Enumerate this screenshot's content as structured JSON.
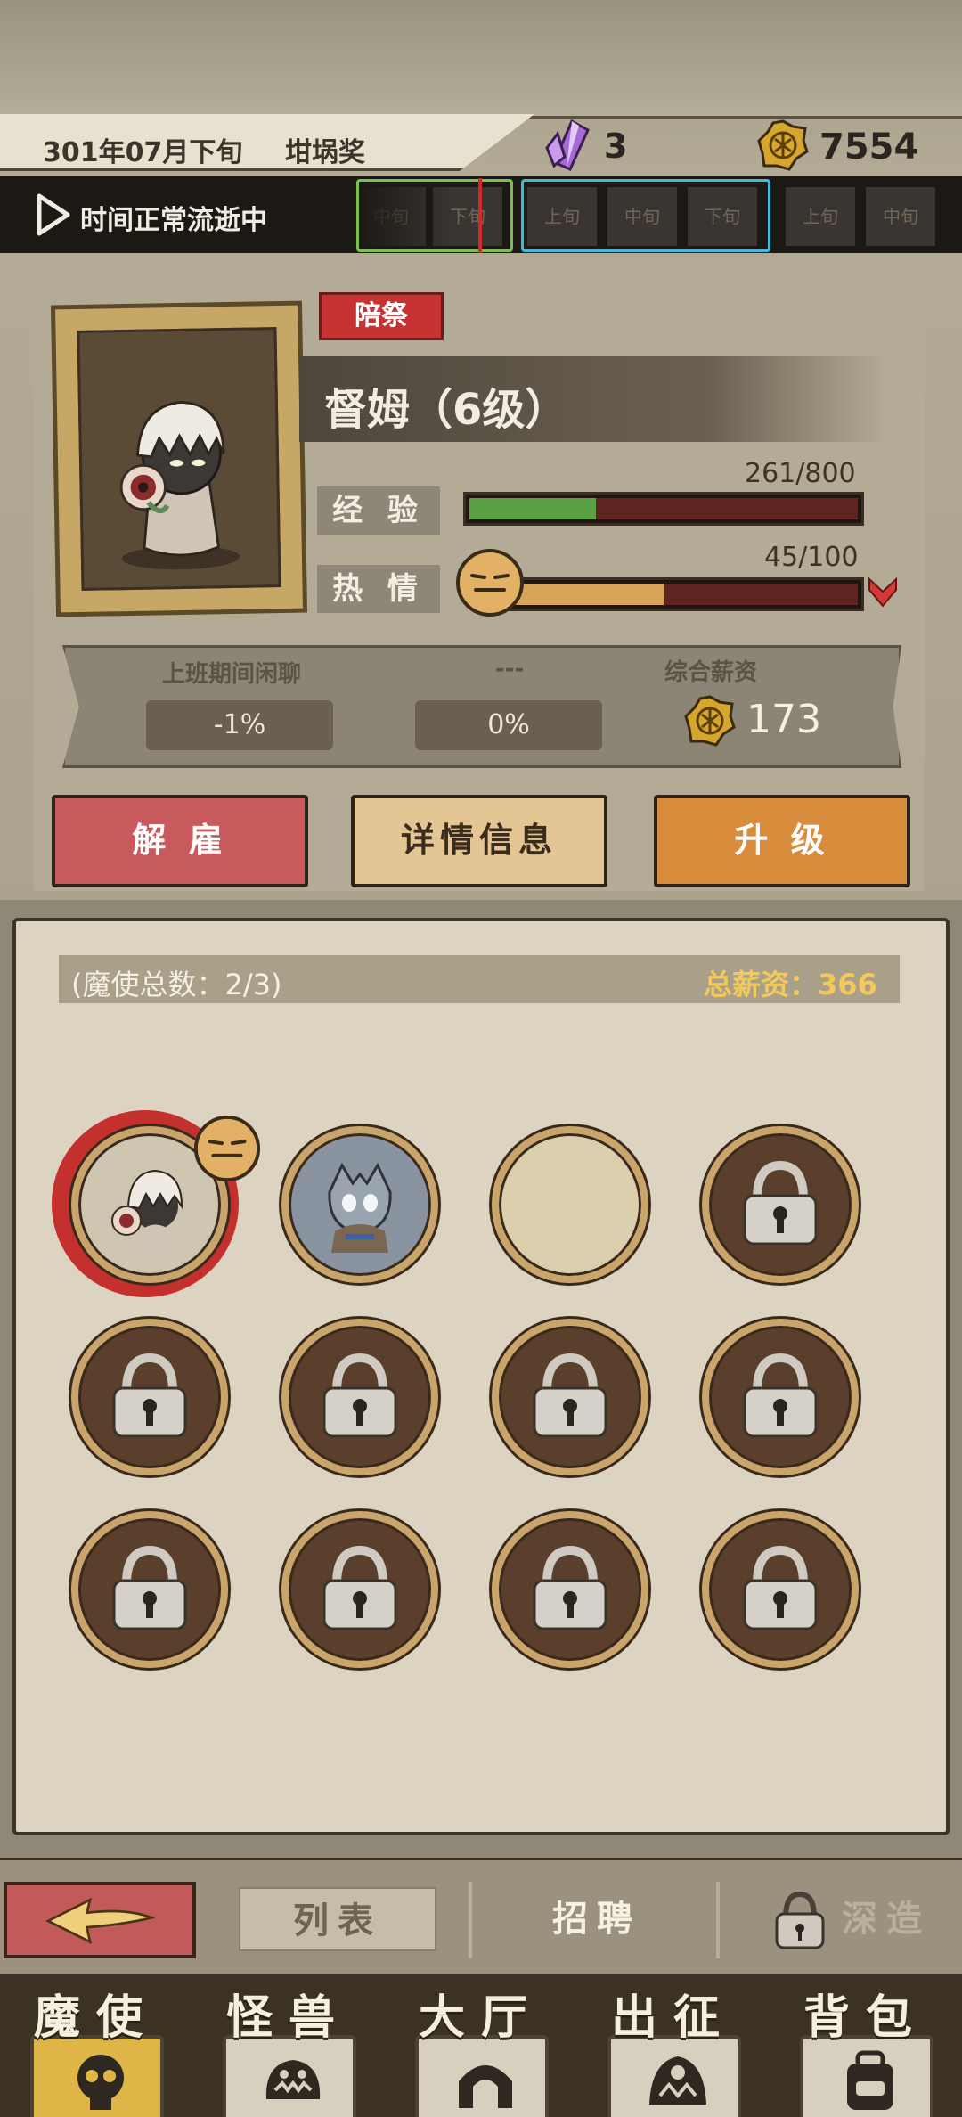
{
  "header": {
    "date": "301年07月下旬",
    "event": "坩埚奖",
    "crystal_count": "3",
    "coin_count": "7554"
  },
  "time_bar": {
    "status": "时间正常流逝中",
    "slots": [
      "中旬",
      "下旬",
      "上旬",
      "中旬",
      "下旬",
      "上旬",
      "中旬"
    ]
  },
  "character": {
    "role_tag": "陪祭",
    "name": "督姆（6级）",
    "exp": {
      "label": "经 验",
      "value_text": "261/800",
      "current": 261,
      "max": 800
    },
    "passion": {
      "label": "热 情",
      "value_text": "45/100",
      "current": 45,
      "max": 100
    },
    "traits": [
      {
        "label": "上班期间闲聊",
        "value": "-1%"
      },
      {
        "label": "---",
        "value": "0%"
      }
    ],
    "salary_label": "综合薪资",
    "salary_value": "173"
  },
  "actions": {
    "fire": "解 雇",
    "details": "详情信息",
    "upgrade": "升 级"
  },
  "roster": {
    "count_text": "(魔使总数：2/3)",
    "total_salary_text": "总薪资：366"
  },
  "subtabs": {
    "list": "列表",
    "recruit": "招聘",
    "deep": "深造"
  },
  "nav": {
    "items": [
      "魔使",
      "怪兽",
      "大厅",
      "出征",
      "背包"
    ]
  },
  "colors": {
    "exp_fill": "#58a043",
    "passion_fill": "#d8a457",
    "fire_button": "#c85a5e",
    "details_button": "#e4c594",
    "upgrade_button": "#d98c3c",
    "salary_highlight": "#f2c95a"
  }
}
